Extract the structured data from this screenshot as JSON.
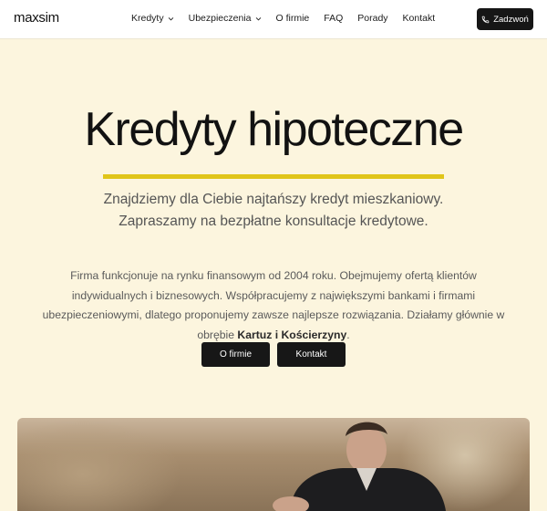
{
  "header": {
    "logo": "maxsim",
    "nav": [
      {
        "label": "Kredyty",
        "dropdown": true
      },
      {
        "label": "Ubezpieczenia",
        "dropdown": true
      },
      {
        "label": "O firmie",
        "dropdown": false
      },
      {
        "label": "FAQ",
        "dropdown": false
      },
      {
        "label": "Porady",
        "dropdown": false
      },
      {
        "label": "Kontakt",
        "dropdown": false
      }
    ],
    "call_button": {
      "label": "Zadzwoń",
      "icon": "phone-icon"
    }
  },
  "hero": {
    "title": "Kredyty hipoteczne",
    "subtitle_line1": "Znajdziemy dla Ciebie najtańszy kredyt mieszkaniowy.",
    "subtitle_line2": "Zapraszamy na bezpłatne konsultacje kredytowe.",
    "description": "Firma funkcjonuje na rynku finansowym od 2004 roku. Obejmujemy ofertą klientów indywidualnych i biznesowych. Współpracujemy z największymi bankami i firmami ubezpieczeniowymi, dlatego proponujemy zawsze najlepsze rozwiązania. Działamy głównie w obrębie",
    "description_bold": "Kartuz i Kościerzyny",
    "description_end": ".",
    "buttons": {
      "about": "O firmie",
      "contact": "Kontakt"
    }
  },
  "colors": {
    "background": "#fcf5de",
    "accent_underline": "#e0c51a",
    "button_dark": "#171717"
  }
}
